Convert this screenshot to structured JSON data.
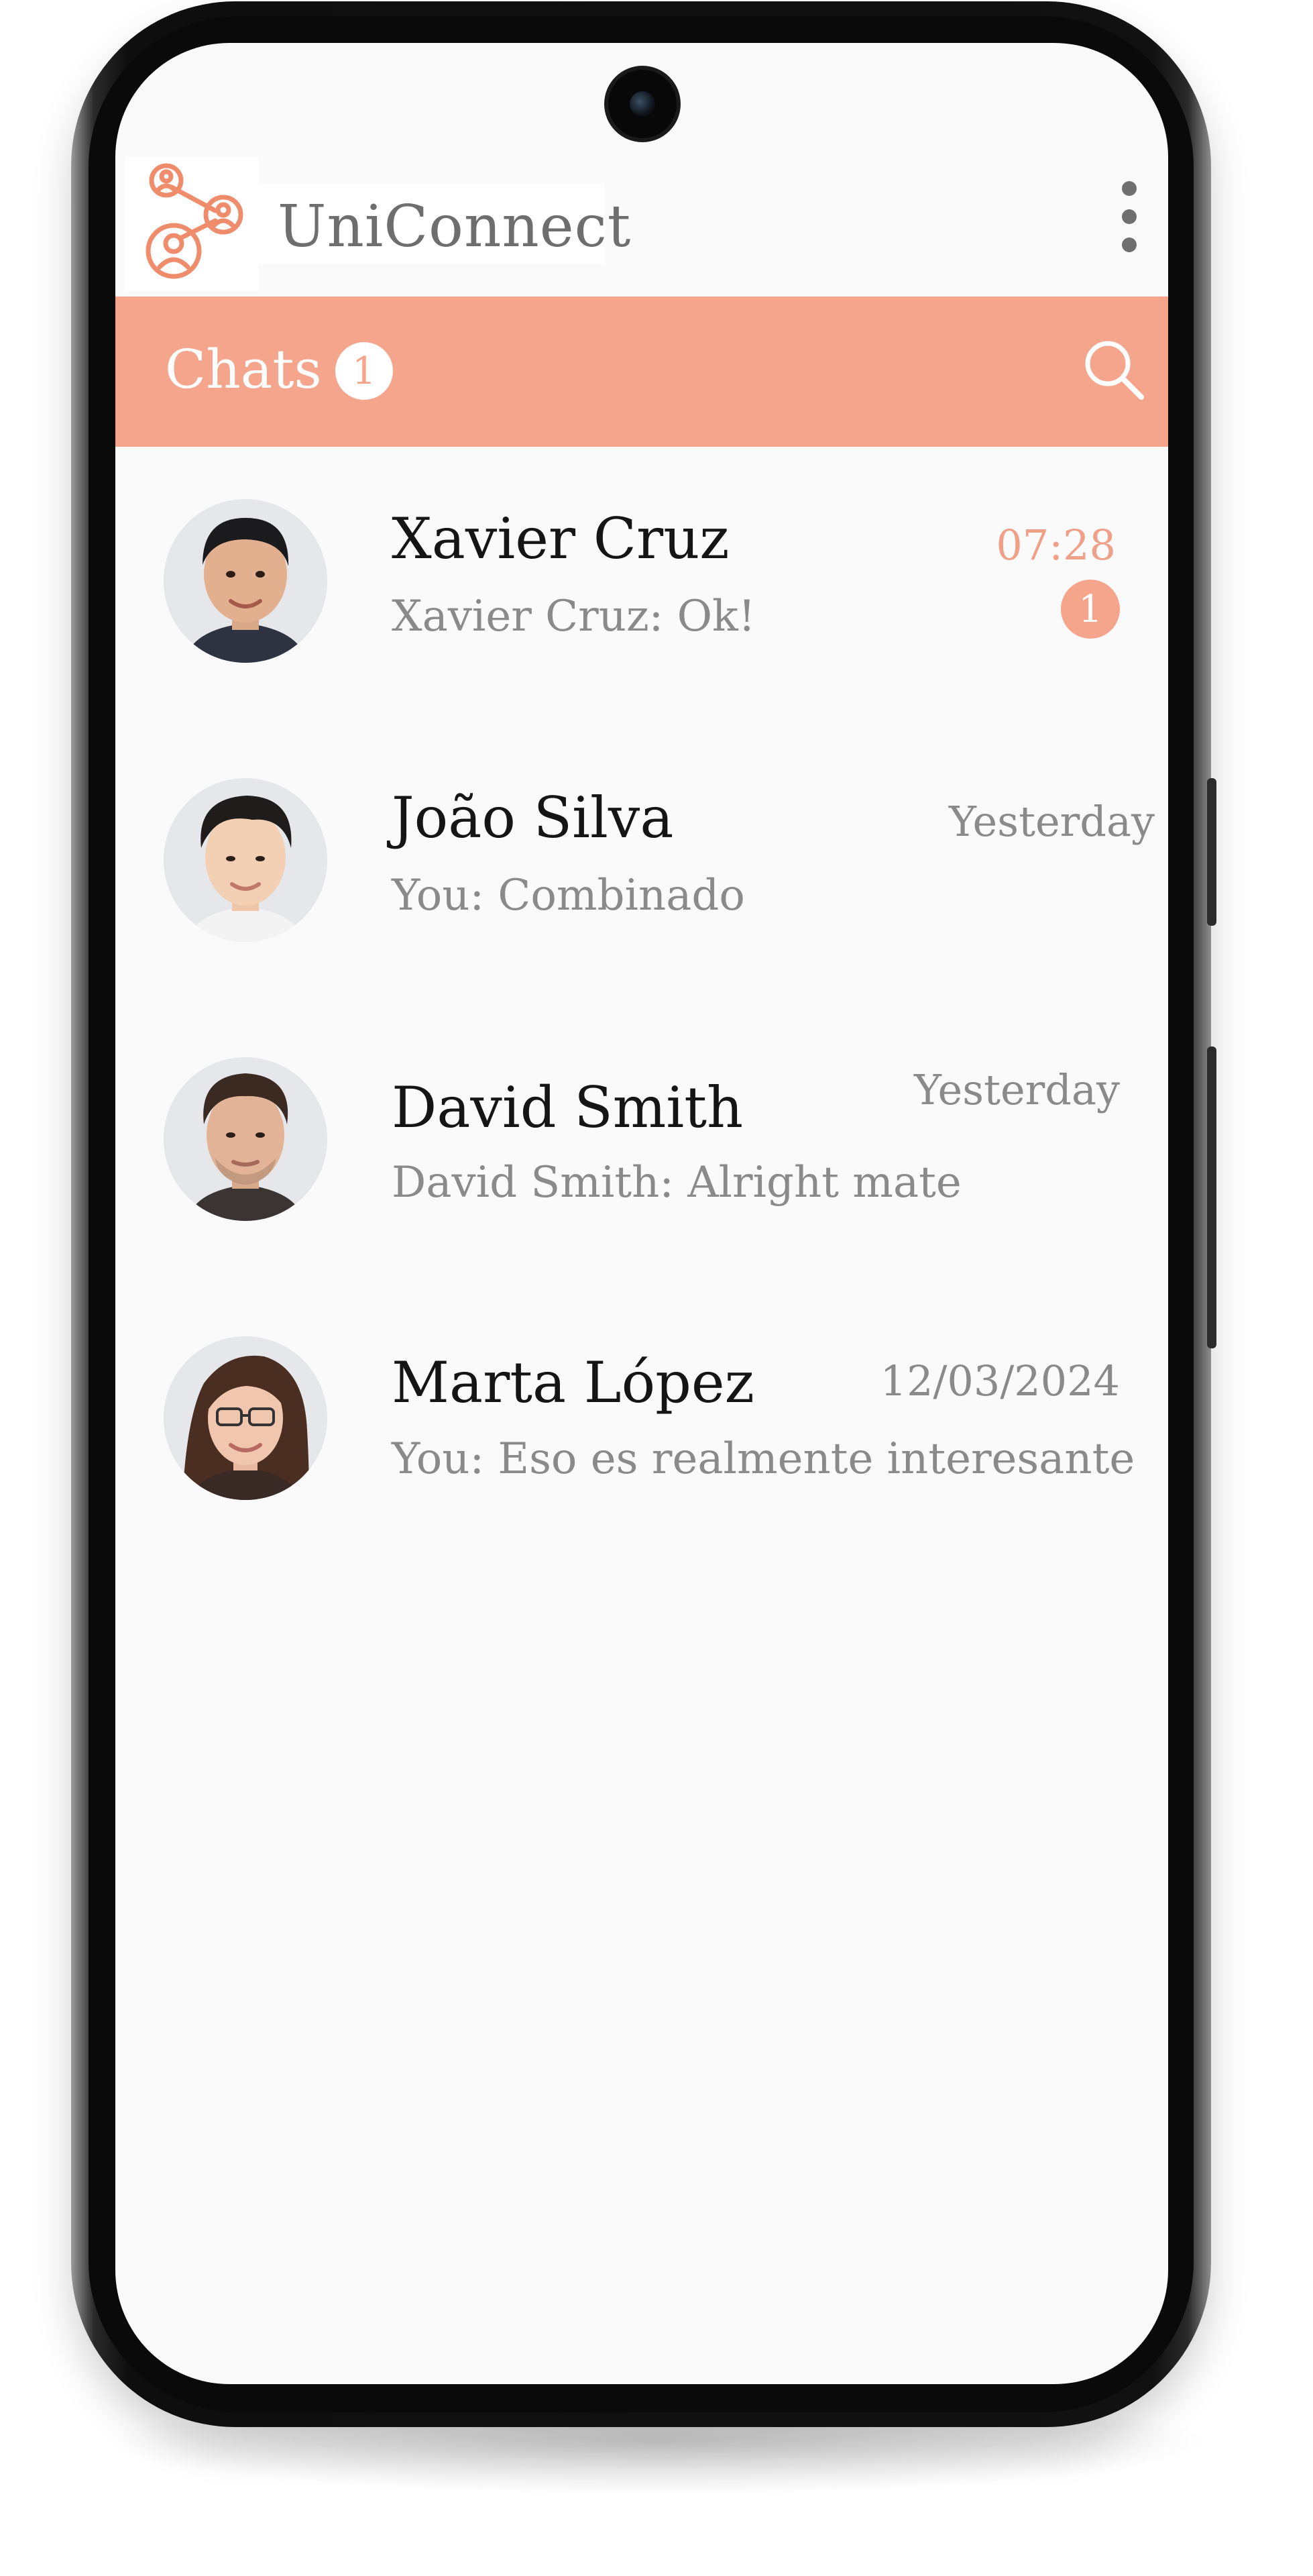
{
  "app": {
    "brand": "UniConnect",
    "menu_icon": "more-vertical-icon",
    "logo_icon": "network-people-icon"
  },
  "chats_bar": {
    "title": "Chats",
    "unread_count": "1",
    "search_icon": "search-icon"
  },
  "chats": [
    {
      "name": "Xavier Cruz",
      "preview": "Xavier Cruz: Ok!",
      "time": "07:28",
      "unread": "1"
    },
    {
      "name": "João Silva",
      "preview": "You: Combinado",
      "time": "Yesterday"
    },
    {
      "name": "David Smith",
      "preview": "David Smith: Alright mate",
      "time": "Yesterday"
    },
    {
      "name": "Marta López",
      "preview": "You: Eso es realmente interesante",
      "time": "12/03/2024"
    }
  ],
  "colors": {
    "accent": "#f4a58c",
    "screen_bg": "#fafafa",
    "muted_text": "#8a8a8a",
    "title_text": "#151515"
  }
}
